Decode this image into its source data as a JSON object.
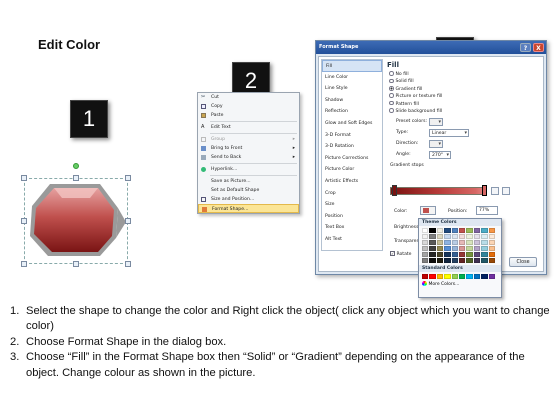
{
  "page": {
    "title": "Edit Color"
  },
  "steps": [
    "1",
    "2",
    "3"
  ],
  "context_menu": {
    "items": [
      {
        "label": "Cut",
        "icon": "scissors-icon",
        "submenu": false,
        "disabled": false,
        "highlight": false
      },
      {
        "label": "Copy",
        "icon": "copy-icon",
        "submenu": false,
        "disabled": false,
        "highlight": false
      },
      {
        "label": "Paste",
        "icon": "paste-icon",
        "submenu": false,
        "disabled": false,
        "highlight": false
      },
      {
        "label": "Edit Text",
        "icon": "text-icon",
        "submenu": false,
        "disabled": false,
        "highlight": false
      },
      {
        "label": "Group",
        "icon": "group-icon",
        "submenu": true,
        "disabled": true,
        "highlight": false
      },
      {
        "label": "Bring to Front",
        "icon": "bring-front-icon",
        "submenu": true,
        "disabled": false,
        "highlight": false
      },
      {
        "label": "Send to Back",
        "icon": "send-back-icon",
        "submenu": true,
        "disabled": false,
        "highlight": false
      },
      {
        "label": "Hyperlink...",
        "icon": "hyperlink-icon",
        "submenu": false,
        "disabled": false,
        "highlight": false
      },
      {
        "label": "Save as Picture...",
        "icon": "",
        "submenu": false,
        "disabled": false,
        "highlight": false
      },
      {
        "label": "Set as Default Shape",
        "icon": "",
        "submenu": false,
        "disabled": false,
        "highlight": false
      },
      {
        "label": "Size and Position...",
        "icon": "size-icon",
        "submenu": false,
        "disabled": false,
        "highlight": false
      },
      {
        "label": "Format Shape...",
        "icon": "format-shape-icon",
        "submenu": false,
        "disabled": false,
        "highlight": true
      }
    ]
  },
  "dialog": {
    "title": "Format Shape",
    "help_label": "?",
    "close_x": "X",
    "nav": [
      "Fill",
      "Line Color",
      "Line Style",
      "Shadow",
      "Reflection",
      "Glow and Soft Edges",
      "3-D Format",
      "3-D Rotation",
      "Picture Corrections",
      "Picture Color",
      "Artistic Effects",
      "Crop",
      "Size",
      "Position",
      "Text Box",
      "Alt Text"
    ],
    "active_nav": 0,
    "fill_heading": "Fill",
    "fill_options": [
      "No fill",
      "Solid fill",
      "Gradient fill",
      "Picture or texture fill",
      "Pattern fill",
      "Slide background fill"
    ],
    "selected_option": 2,
    "preset_label": "Preset colors:",
    "type_label": "Type:",
    "type_value": "Linear",
    "direction_label": "Direction:",
    "angle_label": "Angle:",
    "angle_value": "270°",
    "gradient_stops_label": "Gradient stops",
    "color_label": "Color:",
    "position_label": "Position:",
    "position_value": "77%",
    "brightness_label": "Brightness",
    "transparency_label": "Transparen",
    "rotate_label": "Rotate",
    "close_button": "Close"
  },
  "palette": {
    "theme_heading": "Theme Colors",
    "theme_rows": [
      [
        "#ffffff",
        "#000000",
        "#eeece1",
        "#1f497d",
        "#4f81bd",
        "#c0504d",
        "#9bbb59",
        "#8064a2",
        "#4bacc6",
        "#f79646"
      ],
      [
        "#f2f2f2",
        "#7f7f7f",
        "#ddd9c3",
        "#c6d9f0",
        "#dbe5f1",
        "#f2dcdb",
        "#ebf1dd",
        "#e5e0ec",
        "#dbeef3",
        "#fdeada"
      ],
      [
        "#d8d8d8",
        "#595959",
        "#c4bd97",
        "#8db3e2",
        "#b8cce4",
        "#e5b9b7",
        "#d7e3bc",
        "#ccc1d9",
        "#b7dde8",
        "#fbd5b5"
      ],
      [
        "#bfbfbf",
        "#3f3f3f",
        "#938953",
        "#548dd4",
        "#95b3d7",
        "#d99694",
        "#c3d69b",
        "#b2a2c7",
        "#92cddc",
        "#fac08f"
      ],
      [
        "#a5a5a5",
        "#262626",
        "#494429",
        "#17365d",
        "#366092",
        "#953734",
        "#76923c",
        "#5f497a",
        "#31859b",
        "#e36c09"
      ],
      [
        "#7f7f7f",
        "#0c0c0c",
        "#1d1b10",
        "#0f243e",
        "#244061",
        "#632423",
        "#4f6128",
        "#3f3151",
        "#205867",
        "#974806"
      ]
    ],
    "standard_heading": "Standard Colors",
    "standard_row": [
      "#c00000",
      "#ff0000",
      "#ffc000",
      "#ffff00",
      "#92d050",
      "#00b050",
      "#00b0f0",
      "#0070c0",
      "#002060",
      "#7030a0"
    ],
    "more_label": "More Colors..."
  },
  "instructions": [
    {
      "num": "1.",
      "text": "Select the shape to change the color and Right click the object( click any object which you want to change color)"
    },
    {
      "num": "2.",
      "text": "Choose Format Shape in the dialog box."
    },
    {
      "num": "3.",
      "text": "Choose “Fill” in the Format Shape box then “Solid” or “Gradient” depending on the appearance of the object. Change colour as shown in the picture."
    }
  ],
  "colors": {
    "shape_fill": "#c0504d",
    "shape_dark": "#8b1a1a",
    "highlight": "#fbe596",
    "titlebar": "#2f5fa8"
  }
}
